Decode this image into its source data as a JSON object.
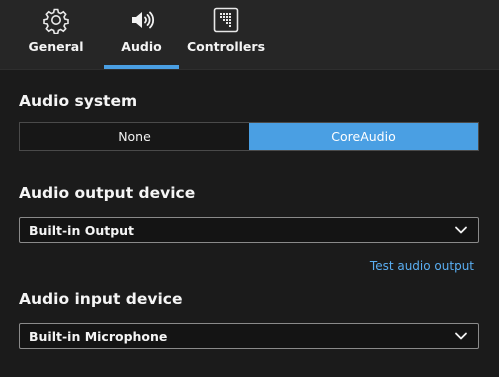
{
  "tabs": [
    {
      "label": "General",
      "icon": "gear-icon"
    },
    {
      "label": "Audio",
      "icon": "speaker-icon"
    },
    {
      "label": "Controllers",
      "icon": "controller-grid-icon"
    }
  ],
  "active_tab": "Audio",
  "colors": {
    "accent": "#4a9fe3",
    "link": "#5aaef2",
    "background": "#1b1b1b"
  },
  "audio_system": {
    "title": "Audio system",
    "options": [
      "None",
      "CoreAudio"
    ],
    "selected": "CoreAudio"
  },
  "output_device": {
    "title": "Audio output device",
    "value": "Built-in Output",
    "test_link": "Test audio output"
  },
  "input_device": {
    "title": "Audio input device",
    "value": "Built-in Microphone"
  }
}
